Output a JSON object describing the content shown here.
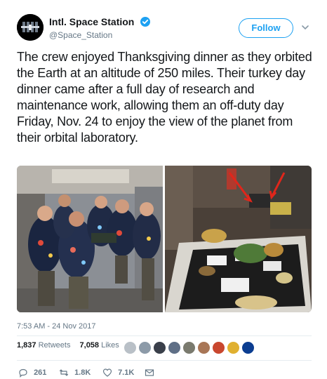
{
  "account": {
    "display_name": "Intl. Space Station",
    "handle": "@Space_Station",
    "verified": true,
    "follow_label": "Follow"
  },
  "tweet": {
    "text": "The crew enjoyed Thanksgiving dinner as they orbited the Earth at an altitude of 250 miles. Their turkey day dinner came after a full day of research and maintenance work, allowing them an off-duty day Friday, Nov. 24 to enjoy the view of the planet from their orbital laboratory.",
    "timestamp": "7:53 AM - 24 Nov 2017"
  },
  "stats": {
    "retweets_count": "1,837",
    "retweets_label": "Retweets",
    "likes_count": "7,058",
    "likes_label": "Likes"
  },
  "actions": {
    "reply_count": "261",
    "retweet_count": "1.8K",
    "like_count": "7.1K"
  },
  "icons": {
    "verified": "verified-badge-icon",
    "caret": "chevron-down-icon",
    "reply": "reply-icon",
    "retweet": "retweet-icon",
    "like": "heart-icon",
    "dm": "envelope-icon"
  },
  "colors": {
    "accent": "#1da1f2",
    "text": "#14171a",
    "muted": "#657786"
  }
}
